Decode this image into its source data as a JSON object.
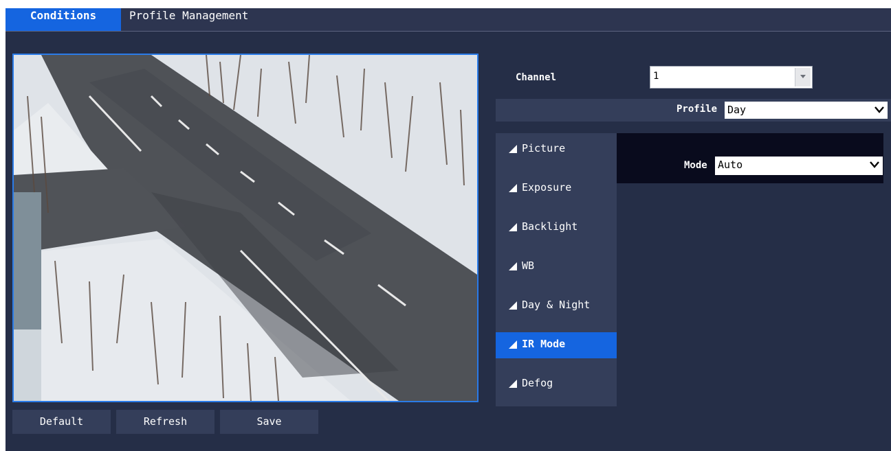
{
  "tabs": [
    {
      "label": "Conditions",
      "active": true
    },
    {
      "label": "Profile Management",
      "active": false
    }
  ],
  "buttons": {
    "default_label": "Default",
    "refresh_label": "Refresh",
    "save_label": "Save"
  },
  "channel": {
    "label": "Channel",
    "value": "1"
  },
  "profile": {
    "label": "Profile",
    "value": "Day"
  },
  "menu": {
    "items": [
      {
        "label": "Picture",
        "active": false
      },
      {
        "label": "Exposure",
        "active": false
      },
      {
        "label": "Backlight",
        "active": false
      },
      {
        "label": "WB",
        "active": false
      },
      {
        "label": "Day & Night",
        "active": false
      },
      {
        "label": "IR Mode",
        "active": true
      },
      {
        "label": "Defog",
        "active": false
      }
    ]
  },
  "ir_mode": {
    "label": "Mode",
    "value": "Auto"
  },
  "colors": {
    "background": "#252e47",
    "accent": "#1565e0",
    "panel": "#343e5a",
    "mode_panel": "#090b1d"
  }
}
